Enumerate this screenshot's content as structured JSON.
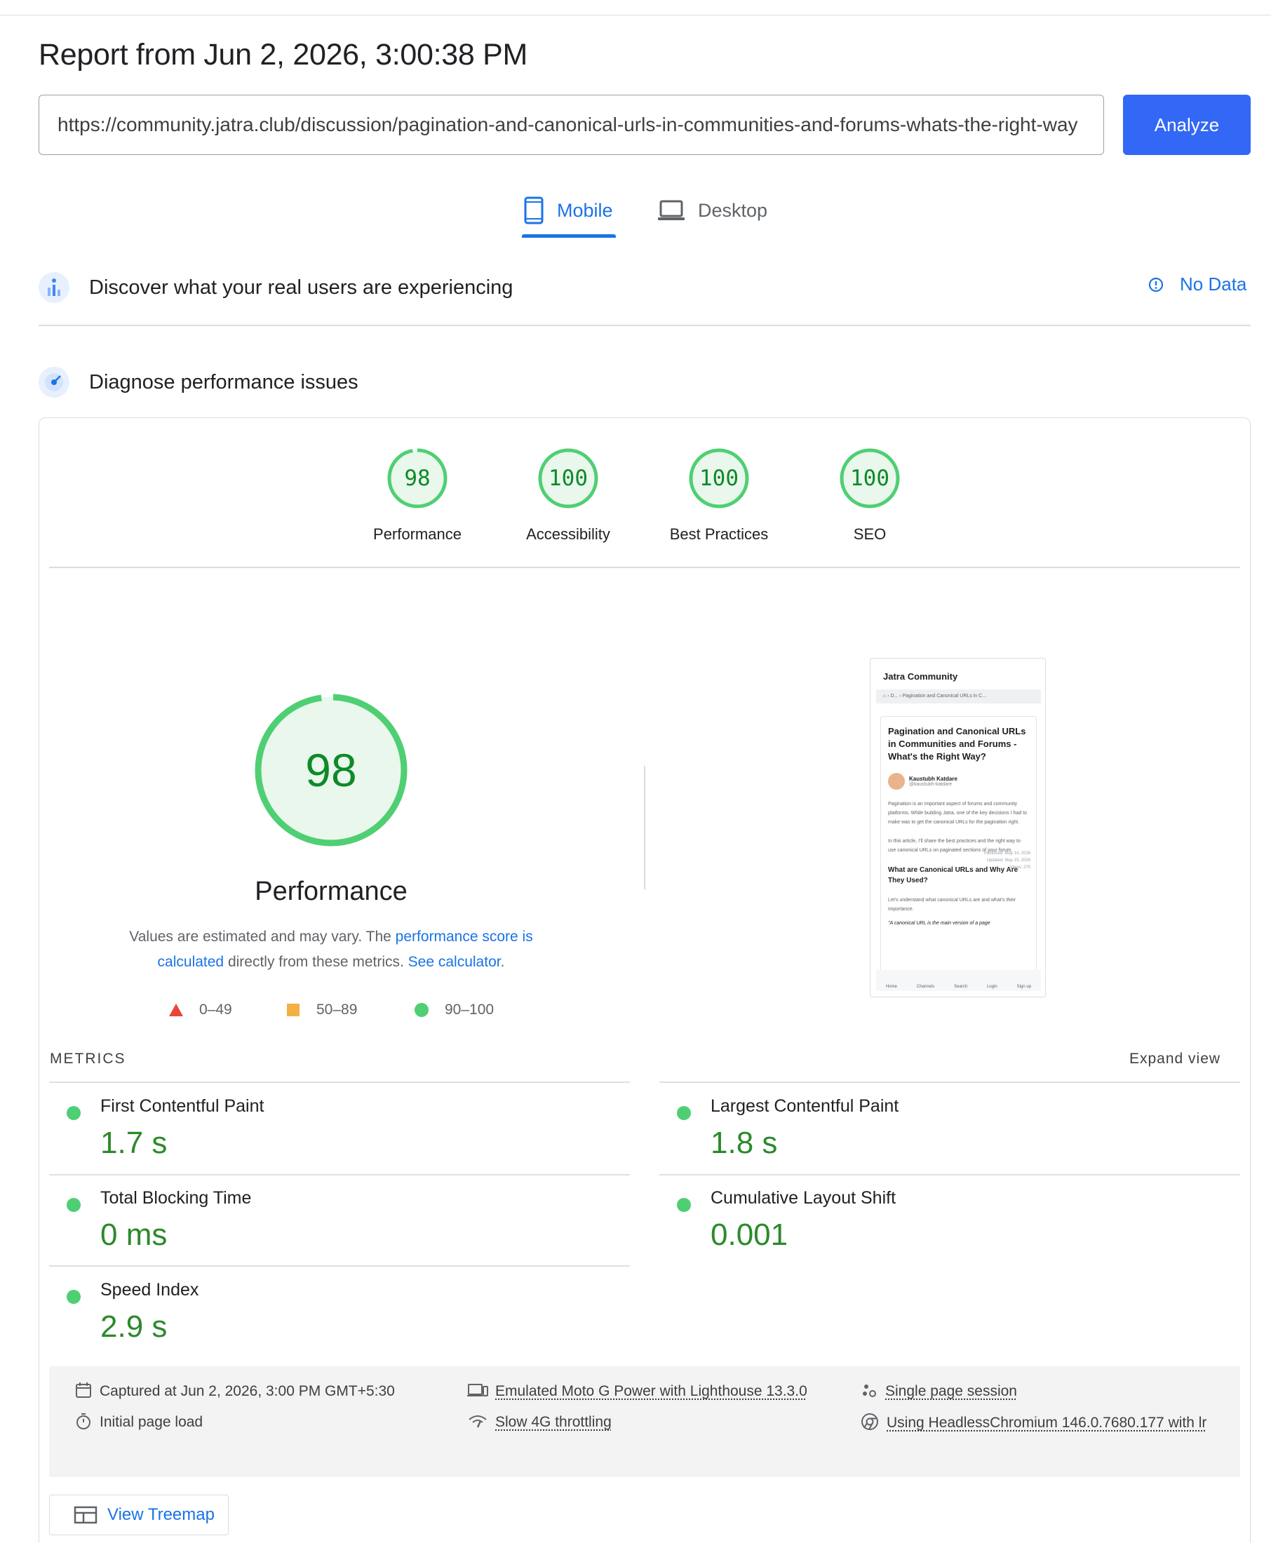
{
  "report": {
    "title": "Report from Jun 2, 2026, 3:00:38 PM",
    "url": "https://community.jatra.club/discussion/pagination-and-canonical-urls-in-communities-and-forums-whats-the-right-way",
    "analyze_label": "Analyze"
  },
  "tabs": [
    {
      "label": "Mobile",
      "icon": "phone-icon",
      "selected": true
    },
    {
      "label": "Desktop",
      "icon": "laptop-icon",
      "selected": false
    }
  ],
  "field_section": {
    "title": "Discover what your real users are experiencing",
    "status": "No Data"
  },
  "lab_section": {
    "title": "Diagnose performance issues"
  },
  "scores": [
    {
      "label": "Performance",
      "value": "98",
      "score": 98
    },
    {
      "label": "Accessibility",
      "value": "100",
      "score": 100
    },
    {
      "label": "Best Practices",
      "value": "100",
      "score": 100
    },
    {
      "label": "SEO",
      "value": "100",
      "score": 100
    }
  ],
  "main_score": {
    "value": "98",
    "score": 98,
    "label": "Performance",
    "desc_1": "Values are estimated and may vary. The ",
    "desc_link_1": "performance score is calculated",
    "desc_2": " directly from these metrics. ",
    "desc_link_2": "See calculator",
    "desc_3": "."
  },
  "legend": [
    {
      "range": "0–49",
      "shape": "triangle",
      "color": "#e8453c"
    },
    {
      "range": "50–89",
      "shape": "square",
      "color": "#f4b043"
    },
    {
      "range": "90–100",
      "shape": "circle",
      "color": "#4fcf73"
    }
  ],
  "colors": {
    "good": "#4fcf73",
    "good_text": "#0d8a2a",
    "accent": "#3367f5",
    "link": "#1a73e8"
  },
  "metrics": {
    "title": "METRICS",
    "expand_label": "Expand view",
    "items": [
      {
        "name": "First Contentful Paint",
        "value": "1.7 s"
      },
      {
        "name": "Largest Contentful Paint",
        "value": "1.8 s"
      },
      {
        "name": "Total Blocking Time",
        "value": "0 ms"
      },
      {
        "name": "Cumulative Layout Shift",
        "value": "0.001"
      },
      {
        "name": "Speed Index",
        "value": "2.9 s"
      }
    ]
  },
  "environment": {
    "captured": "Captured at Jun 2, 2026, 3:00 PM GMT+5:30",
    "load": "Initial page load",
    "device": "Emulated Moto G Power with Lighthouse 13.3.0",
    "throttling": "Slow 4G throttling",
    "session": "Single page session",
    "browser": "Using HeadlessChromium 146.0.7680.177 with lr"
  },
  "treemap_label": "View Treemap",
  "thumbnail": {
    "site": "Jatra Community",
    "crumb": "D...  ›  Pagination and Canonical URLs in C...",
    "title": "Pagination and Canonical URLs in Communities and Forums - What's the Right Way?",
    "author": "Kaustubh Katdare",
    "handle": "@kaustubh-katdare",
    "published": "Published: May 14, 2026",
    "updated": "Updated: May 15, 2026",
    "views": "Views: 275",
    "p1": "Pagination is an important aspect of forums and community platforms. While building Jatra, one of the key decisions I had to make was to get the canonical URLs for the pagination right.",
    "p2": "In this article, I'll share the best practices and the right way to use canonical URLs on paginated sections of your forum.",
    "h2": "What are Canonical URLs and Why Are They Used?",
    "p3": "Let's understand what canonical URLs are and what's their importance.",
    "quote": "\"A canonical URL is the main version of a page",
    "nav": [
      "Home",
      "Channels",
      "Search",
      "Login",
      "Sign up"
    ]
  }
}
